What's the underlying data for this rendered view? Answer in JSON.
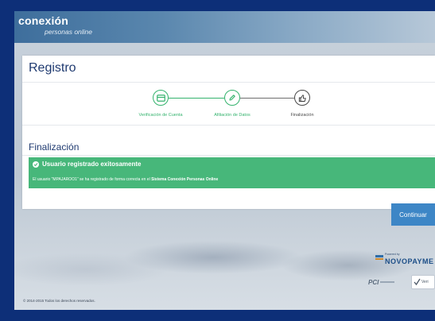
{
  "header": {
    "logo_main": "conexión",
    "logo_sub": "personas online"
  },
  "card": {
    "title": "Registro",
    "steps": [
      {
        "label": "Verificación de Cuenta",
        "status": "done",
        "icon": "card-icon"
      },
      {
        "label": "Afiliación de Datos",
        "status": "done",
        "icon": "pencil-icon"
      },
      {
        "label": "Finalización",
        "status": "current",
        "icon": "thumbs-up-icon"
      }
    ],
    "section_title": "Finalización",
    "alert": {
      "title": "Usuario registrado exitosamente",
      "message_prefix": "El usuario \"MPAJAROO1\" se ha registrado de forma correcta en el ",
      "message_bold": "Sistema Conexión Personas Online",
      "color": "#47b77a"
    }
  },
  "actions": {
    "continue_label": "Continuar"
  },
  "partners": {
    "powered_by": "Powered by",
    "novo_name": "NOVOPAYME",
    "pci_label": "PCI",
    "verified_label": "Veri"
  },
  "footer": {
    "copyright": "© 2014-2015 Todos los derechos reservados."
  },
  "colors": {
    "background": "#0d2f78",
    "accent_green": "#35b36e",
    "button_blue": "#3d86c6",
    "title_blue": "#1f3a70"
  }
}
